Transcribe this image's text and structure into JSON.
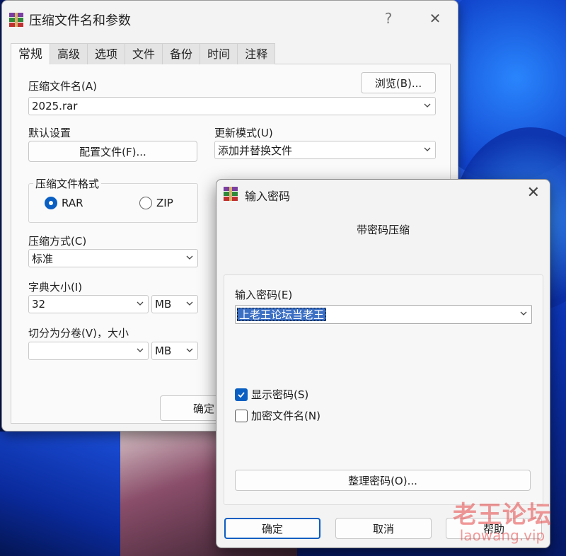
{
  "main_window": {
    "title": "压缩文件名和参数",
    "help_glyph": "?",
    "close_glyph": "✕",
    "tabs": [
      {
        "label": "常规",
        "active": true
      },
      {
        "label": "高级"
      },
      {
        "label": "选项"
      },
      {
        "label": "文件"
      },
      {
        "label": "备份"
      },
      {
        "label": "时间"
      },
      {
        "label": "注释"
      }
    ],
    "archive_name_label": "压缩文件名(A)",
    "browse_button": "浏览(B)...",
    "archive_name_value": "2025.rar",
    "default_settings_label": "默认设置",
    "profiles_button": "配置文件(F)...",
    "update_mode_label": "更新模式(U)",
    "update_mode_value": "添加并替换文件",
    "format_group_label": "压缩文件格式",
    "format_options": [
      {
        "label": "RAR",
        "selected": true
      },
      {
        "label": "ZIP",
        "selected": false
      }
    ],
    "method_label": "压缩方式(C)",
    "method_value": "标准",
    "dict_label": "字典大小(I)",
    "dict_value": "32",
    "dict_unit": "MB",
    "split_label": "切分为分卷(V)，大小",
    "split_value": "",
    "split_unit": "MB",
    "ok_button_partial": "确定"
  },
  "password_dialog": {
    "title": "输入密码",
    "close_glyph": "✕",
    "subtitle": "带密码压缩",
    "input_label": "输入密码(E)",
    "password_value": "上老王论坛当老王",
    "show_password": {
      "label": "显示密码(S)",
      "checked": true
    },
    "encrypt_names": {
      "label": "加密文件名(N)",
      "checked": false
    },
    "organize_button": "整理密码(O)...",
    "ok_button": "确定",
    "cancel_button": "取消",
    "help_button": "帮助"
  },
  "watermark": {
    "title": "老王论坛",
    "url": "laowang.vip"
  },
  "colors": {
    "accent": "#0a5fc2",
    "selection": "#3b6fc4",
    "window_bg": "#f3f3f3"
  }
}
